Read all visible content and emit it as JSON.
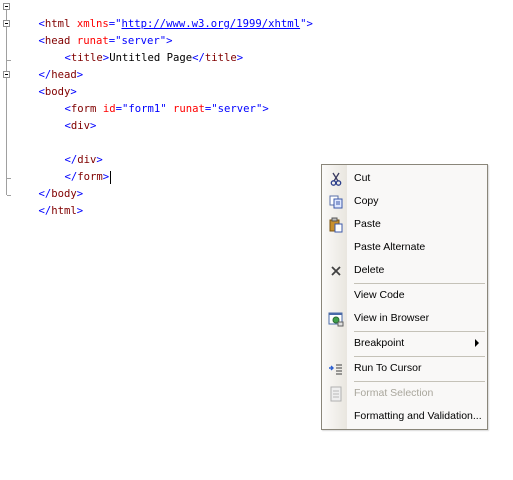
{
  "code": {
    "lines": [
      {
        "l0": "<",
        "l1": "html",
        "l2": " ",
        "l3": "xmlns",
        "l4": "=\"",
        "l5": "http://www.w3.org/1999/xhtml",
        "l6": "\">"
      },
      {
        "l0": "<",
        "l1": "head",
        "l2": " ",
        "l3": "runat",
        "l4": "=\"",
        "l5": "server",
        "l6": "\">"
      },
      {
        "l0": "<",
        "l1": "title",
        "l2": ">",
        "l3": "Untitled Page",
        "l4": "</",
        "l5": "title",
        "l6": ">"
      },
      {
        "l0": "</",
        "l1": "head",
        "l2": ">"
      },
      {
        "l0": "<",
        "l1": "body",
        "l2": ">"
      },
      {
        "l0": "<",
        "l1": "form",
        "l2": " ",
        "l3": "id",
        "l4": "=\"",
        "l5": "form1",
        "l6": "\" ",
        "l7": "runat",
        "l8": "=\"",
        "l9": "server",
        "l10": "\">"
      },
      {
        "l0": "<",
        "l1": "div",
        "l2": ">"
      },
      {},
      {
        "l0": "</",
        "l1": "div",
        "l2": ">"
      },
      {
        "l0": "</",
        "l1": "form",
        "l2": ">"
      },
      {
        "l0": "</",
        "l1": "body",
        "l2": ">"
      },
      {
        "l0": "</",
        "l1": "html",
        "l2": ">"
      }
    ]
  },
  "context_menu": {
    "items": [
      {
        "label": "Cut",
        "icon": "scissors-icon"
      },
      {
        "label": "Copy",
        "icon": "copy-icon"
      },
      {
        "label": "Paste",
        "icon": "paste-icon"
      },
      {
        "label": "Paste Alternate"
      },
      {
        "label": "Delete",
        "icon": "delete-x-icon"
      },
      {
        "label": "View Code"
      },
      {
        "label": "View in Browser",
        "icon": "browser-icon"
      },
      {
        "label": "Breakpoint",
        "submenu": true
      },
      {
        "label": "Run To Cursor",
        "icon": "run-to-cursor-icon"
      },
      {
        "label": "Format Selection",
        "disabled": true,
        "icon": "format-selection-icon"
      },
      {
        "label": "Formatting and Validation..."
      }
    ]
  }
}
